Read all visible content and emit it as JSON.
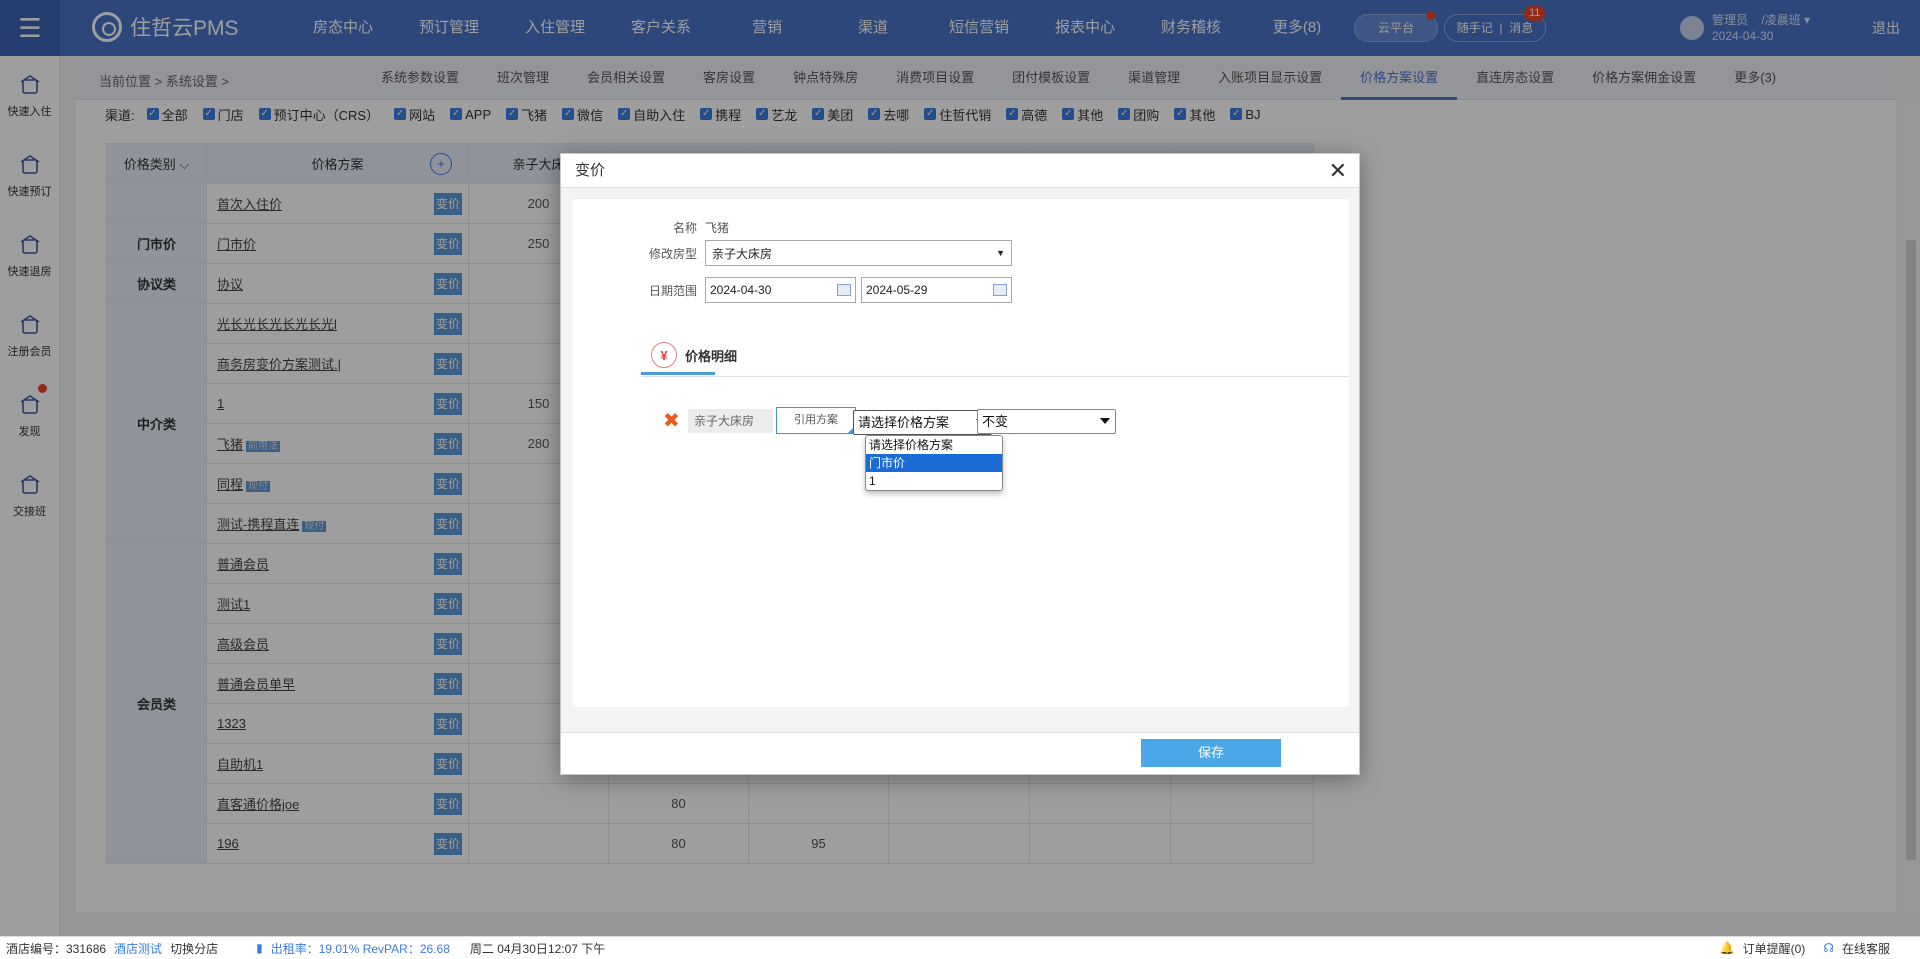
{
  "header": {
    "logo": "住哲云PMS",
    "nav": [
      "房态中心",
      "预订管理",
      "入住管理",
      "客户关系",
      "营销",
      "渠道",
      "短信营销",
      "报表中心",
      "财务稽核",
      "更多(8)"
    ],
    "cloud": "云平台",
    "notes": "随手记",
    "messages": "消息",
    "msg_count": "11",
    "user_role": "管理员",
    "user_name": "/凌晨班",
    "user_date": "2024-04-30",
    "logout": "退出"
  },
  "sidebar": [
    {
      "label": "快速入住",
      "icon": "home-enter-icon"
    },
    {
      "label": "快速预订",
      "icon": "document-icon"
    },
    {
      "label": "快速退房",
      "icon": "home-exit-icon"
    },
    {
      "label": "注册会员",
      "icon": "user-add-icon"
    },
    {
      "label": "发现",
      "icon": "discover-icon"
    },
    {
      "label": "交接班",
      "icon": "user-swap-icon"
    }
  ],
  "breadcrumb": "当前位置 > 系统设置 >",
  "subtabs": [
    "系统参数设置",
    "班次管理",
    "会员相关设置",
    "客房设置",
    "钟点特殊房",
    "消费项目设置",
    "团付模板设置",
    "渠道管理",
    "入账项目显示设置",
    "价格方案设置",
    "直连房态设置",
    "价格方案佣金设置",
    "更多(3)"
  ],
  "active_subtab": "价格方案设置",
  "channels": {
    "label": "渠道:",
    "items": [
      "全部",
      "门店",
      "预订中心（CRS）",
      "网站",
      "APP",
      "飞猪",
      "微信",
      "自助入住",
      "携程",
      "艺龙",
      "美团",
      "去哪",
      "住哲代销",
      "高德",
      "其他",
      "团购",
      "其他",
      "BJ"
    ]
  },
  "table": {
    "headers": [
      "价格类别",
      "价格方案",
      "亲子大床"
    ],
    "rows": [
      {
        "cat": "",
        "name": "首次入住价",
        "tag": "",
        "v1": "200",
        "v2": "",
        "v3": ""
      },
      {
        "cat": "门市价",
        "name": "门市价",
        "tag": "",
        "v1": "250",
        "v2": "",
        "v3": ""
      },
      {
        "cat": "协议类",
        "name": "协议",
        "tag": "",
        "v1": "",
        "v2": "",
        "v3": ""
      },
      {
        "cat": "",
        "name": "光长光长光长光长光l",
        "tag": "",
        "v1": "",
        "v2": "",
        "v3": ""
      },
      {
        "cat": "",
        "name": "商务房变价方案测试.|",
        "tag": "",
        "v1": "",
        "v2": "",
        "v3": ""
      },
      {
        "cat": "",
        "name": "1",
        "tag": "",
        "v1": "150",
        "v2": "",
        "v3": ""
      },
      {
        "cat": "中介类",
        "name": "飞猪",
        "tag": "前用法",
        "v1": "280",
        "v2": "",
        "v3": ""
      },
      {
        "cat": "",
        "name": "同程",
        "tag": "现付",
        "v1": "",
        "v2": "",
        "v3": ""
      },
      {
        "cat": "",
        "name": "测试-携程直连",
        "tag": "现付",
        "v1": "",
        "v2": "",
        "v3": ""
      },
      {
        "cat": "",
        "name": "普通会员",
        "tag": "",
        "v1": "",
        "v2": "",
        "v3": ""
      },
      {
        "cat": "",
        "name": "测试1",
        "tag": "",
        "v1": "",
        "v2": "",
        "v3": ""
      },
      {
        "cat": "",
        "name": "高级会员",
        "tag": "",
        "v1": "",
        "v2": "",
        "v3": ""
      },
      {
        "cat": "",
        "name": "普通会员单早",
        "tag": "",
        "v1": "",
        "v2": "",
        "v3": ""
      },
      {
        "cat": "会员类",
        "name": "1323",
        "tag": "",
        "v1": "",
        "v2": "",
        "v3": ""
      },
      {
        "cat": "",
        "name": "自助机1",
        "tag": "",
        "v1": "",
        "v2": "",
        "v3": ""
      },
      {
        "cat": "",
        "name": "直客通价格joe",
        "tag": "",
        "v1": "",
        "v2": "80",
        "v3": ""
      },
      {
        "cat": "",
        "name": "196",
        "tag": "",
        "v1": "",
        "v2": "80",
        "v3": "95"
      }
    ],
    "btn_label": "变价"
  },
  "modal": {
    "title": "变价",
    "name_label": "名称",
    "name_value": "飞猪",
    "room_label": "修改房型",
    "room_value": "亲子大床房",
    "date_label": "日期范围",
    "date_from": "2024-04-30",
    "date_to": "2024-05-29",
    "tab_label": "价格明细",
    "row_room": "亲子大床房",
    "cite_btn": "引用方案",
    "plan_select": "请选择价格方案",
    "plan_options": [
      "请选择价格方案",
      "门市价",
      "1"
    ],
    "plan_selected_index": 1,
    "change_select": "不变",
    "save": "保存"
  },
  "status": {
    "hotel_no": "酒店编号：331686",
    "hotel_name": "酒店测试",
    "switch": "切换分店",
    "occupancy": "出租率：19.01% RevPAR：26.68",
    "datetime": "周二 04月30日12:07 下午",
    "order_remind": "订单提醒(0)",
    "support": "在线客服"
  },
  "colors": {
    "topbar": "#4a73c6",
    "accent": "#4aa8e8",
    "danger": "#e85a1e"
  }
}
